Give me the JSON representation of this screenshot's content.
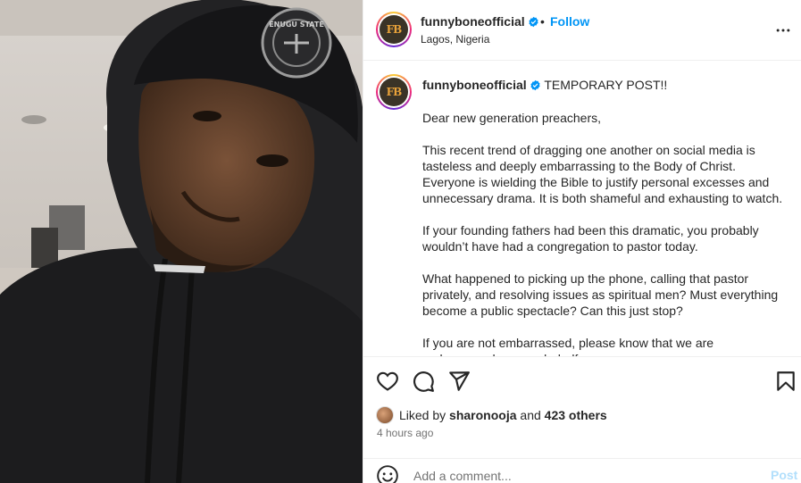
{
  "post": {
    "username": "funnyboneofficial",
    "location": "Lagos, Nigeria",
    "follow_label": "Follow",
    "separator": "•",
    "avatar_text": "FB"
  },
  "caption": {
    "username": "funnyboneofficial",
    "title": "TEMPORARY POST!!",
    "paragraphs": [
      "Dear new generation preachers,",
      "This recent trend of dragging one another on social media is tasteless and deeply embarrassing to the Body of Christ. Everyone is wielding the Bible to justify personal excesses and unnecessary drama. It is both shameful and exhausting to watch.",
      "If your founding fathers had been this dramatic, you probably wouldn’t have had a congregation to pastor today.",
      "What happened to picking up the phone, calling that pastor privately, and resolving issues as spiritual men? Must everything become a public spectacle? Can this just stop?",
      "If you are not embarrassed, please know that we are embarrassed on your behalf."
    ]
  },
  "photo": {
    "cap_patch_text": "ENUGU STATE"
  },
  "engagement": {
    "liked_by_prefix": "Liked by",
    "liked_by_user": "sharonooja",
    "and_label": "and",
    "others_label": "423 others",
    "time_ago": "4 hours ago"
  },
  "comment": {
    "placeholder": "Add a comment...",
    "post_label": "Post"
  },
  "icons": [
    "verified-badge-icon",
    "more-options-icon",
    "heart-icon",
    "comment-icon",
    "share-icon",
    "bookmark-icon",
    "emoji-icon"
  ],
  "colors": {
    "accent": "#0095f6",
    "post_disabled": "#b2dffc",
    "text": "#262626",
    "muted": "#737373"
  }
}
